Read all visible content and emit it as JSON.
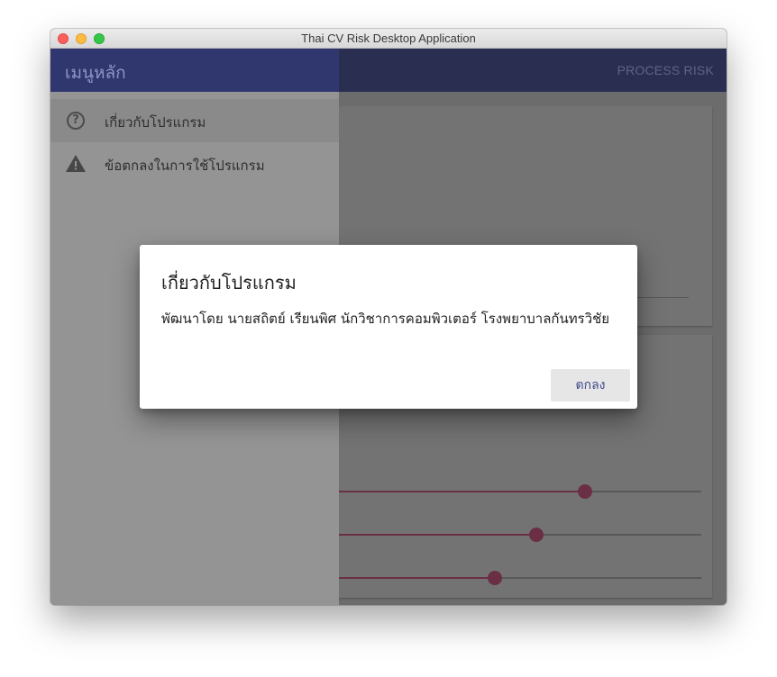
{
  "window": {
    "title": "Thai CV Risk Desktop Application"
  },
  "appbar": {
    "action_label": "PROCESS RISK"
  },
  "drawer": {
    "title": "เมนูหลัก",
    "items": [
      {
        "label": "เกี่ยวกับโปรแกรม",
        "icon": "help-circle-icon",
        "active": true
      },
      {
        "label": "ข้อตกลงในการใช้โปรแกรม",
        "icon": "warning-icon",
        "active": false
      }
    ]
  },
  "dialog": {
    "title": "เกี่ยวกับโปรแกรม",
    "body": "พัฒนาโดย นายสถิตย์ เรียนพิศ นักวิชาการคอมพิวเตอร์ โรงพยาบาลกันทรวิชัย",
    "ok_label": "ตกลง"
  },
  "colors": {
    "appbar": "#2a2f52",
    "drawer_header": "#2f376e",
    "slider_accent": "#6b2f45",
    "dialog_button_text": "#3f4a8a"
  },
  "sliders": [
    {
      "value": 0.69
    },
    {
      "value": 0.56
    },
    {
      "value": 0.45
    }
  ]
}
